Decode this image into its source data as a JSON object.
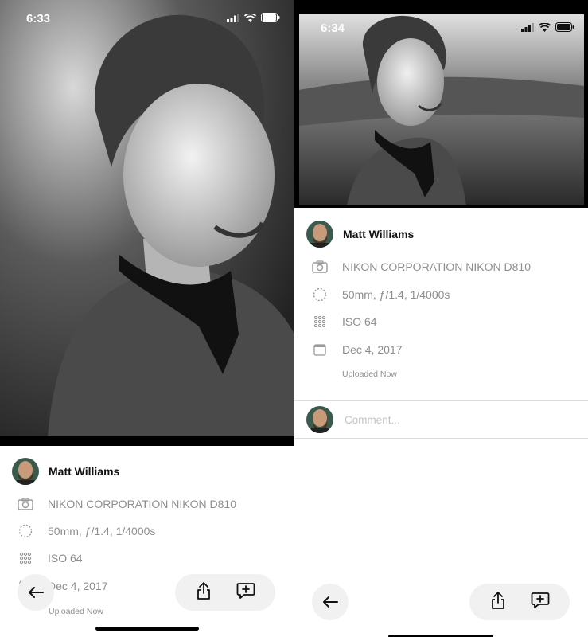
{
  "screens": [
    {
      "status": {
        "time": "6:33"
      },
      "author": {
        "name": "Matt Williams"
      },
      "details": [
        {
          "icon": "camera-icon",
          "text": "NIKON CORPORATION NIKON D810"
        },
        {
          "icon": "aperture-icon",
          "text": "50mm, ƒ/1.4, 1/4000s"
        },
        {
          "icon": "iso-grid-icon",
          "text": "ISO 64"
        },
        {
          "icon": "calendar-icon",
          "text": "Dec 4, 2017"
        }
      ],
      "uploaded": "Uploaded Now"
    },
    {
      "status": {
        "time": "6:34"
      },
      "author": {
        "name": "Matt Williams"
      },
      "details": [
        {
          "icon": "camera-icon",
          "text": "NIKON CORPORATION NIKON D810"
        },
        {
          "icon": "aperture-icon",
          "text": "50mm, ƒ/1.4, 1/4000s"
        },
        {
          "icon": "iso-grid-icon",
          "text": "ISO 64"
        },
        {
          "icon": "calendar-icon",
          "text": "Dec 4, 2017"
        }
      ],
      "uploaded": "Uploaded Now",
      "comment": {
        "placeholder": "Comment..."
      }
    }
  ],
  "colors": {
    "muted_text": "#8e8e8e",
    "button_bg": "#f1f1f1",
    "placeholder": "#c4c4c4"
  }
}
